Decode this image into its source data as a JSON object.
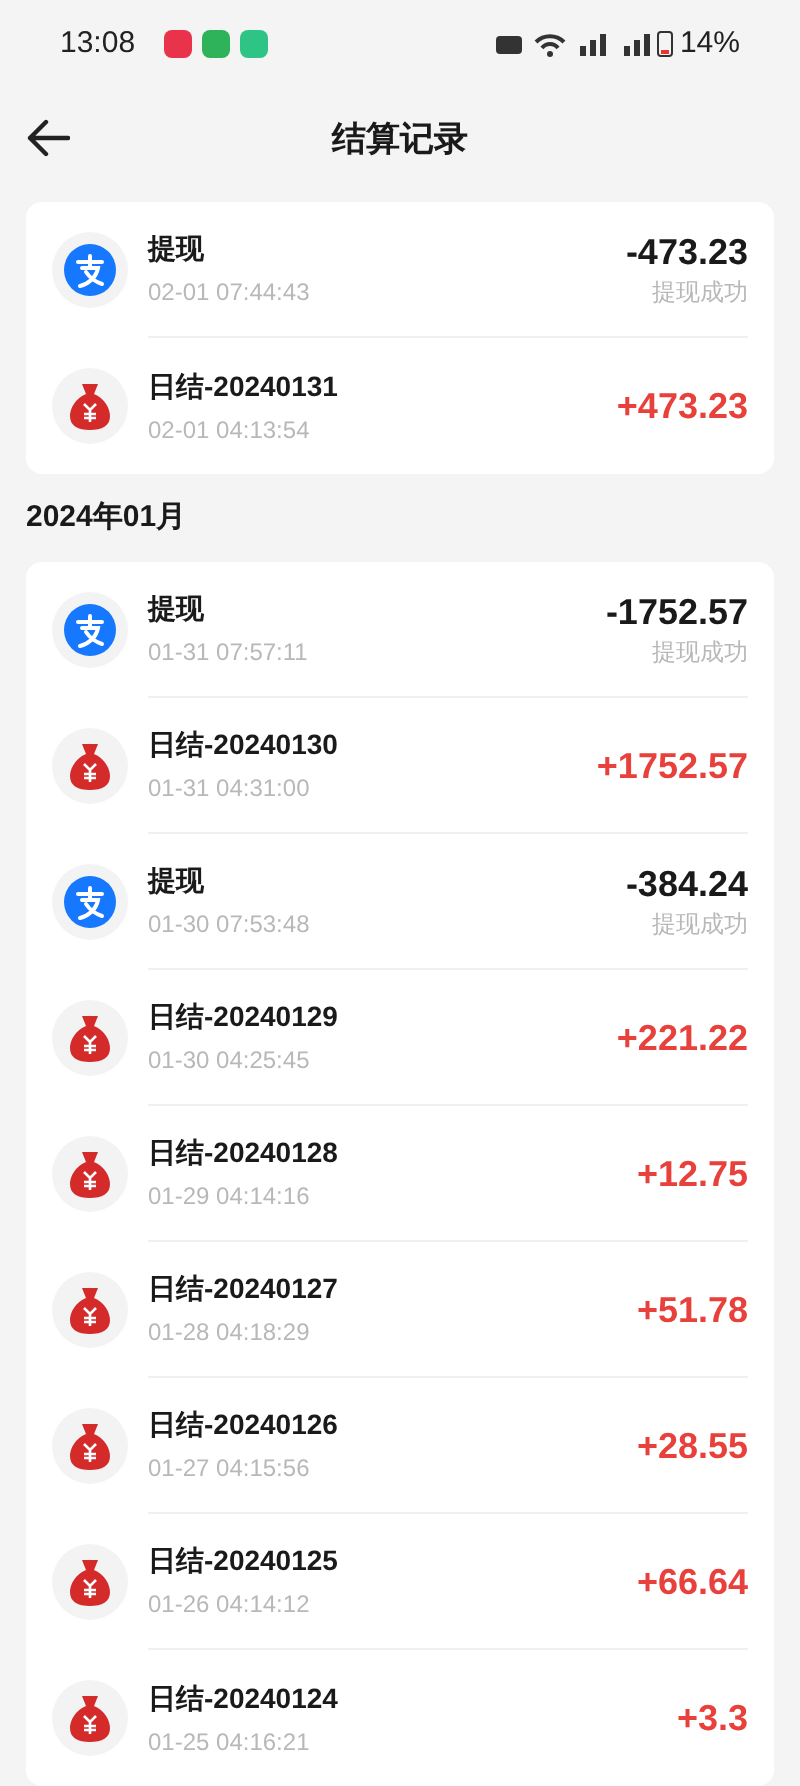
{
  "status_bar": {
    "time": "13:08",
    "notifications": [
      {
        "color": "#e8334a"
      },
      {
        "color": "#2fb35a"
      },
      {
        "color": "#2ec486"
      }
    ],
    "battery": "14%"
  },
  "header": {
    "title": "结算记录"
  },
  "groups": [
    {
      "items": [
        {
          "kind": "withdraw",
          "title": "提现",
          "time": "02-01 07:44:43",
          "amount": "-473.23",
          "status": "提现成功"
        },
        {
          "kind": "settle",
          "title": "日结-20240131",
          "time": "02-01 04:13:54",
          "amount": "+473.23"
        }
      ]
    },
    {
      "heading": "2024年01月",
      "items": [
        {
          "kind": "withdraw",
          "title": "提现",
          "time": "01-31 07:57:11",
          "amount": "-1752.57",
          "status": "提现成功"
        },
        {
          "kind": "settle",
          "title": "日结-20240130",
          "time": "01-31 04:31:00",
          "amount": "+1752.57"
        },
        {
          "kind": "withdraw",
          "title": "提现",
          "time": "01-30 07:53:48",
          "amount": "-384.24",
          "status": "提现成功"
        },
        {
          "kind": "settle",
          "title": "日结-20240129",
          "time": "01-30 04:25:45",
          "amount": "+221.22"
        },
        {
          "kind": "settle",
          "title": "日结-20240128",
          "time": "01-29 04:14:16",
          "amount": "+12.75"
        },
        {
          "kind": "settle",
          "title": "日结-20240127",
          "time": "01-28 04:18:29",
          "amount": "+51.78"
        },
        {
          "kind": "settle",
          "title": "日结-20240126",
          "time": "01-27 04:15:56",
          "amount": "+28.55"
        },
        {
          "kind": "settle",
          "title": "日结-20240125",
          "time": "01-26 04:14:12",
          "amount": "+66.64"
        },
        {
          "kind": "settle",
          "title": "日结-20240124",
          "time": "01-25 04:16:21",
          "amount": "+3.3"
        }
      ]
    }
  ]
}
